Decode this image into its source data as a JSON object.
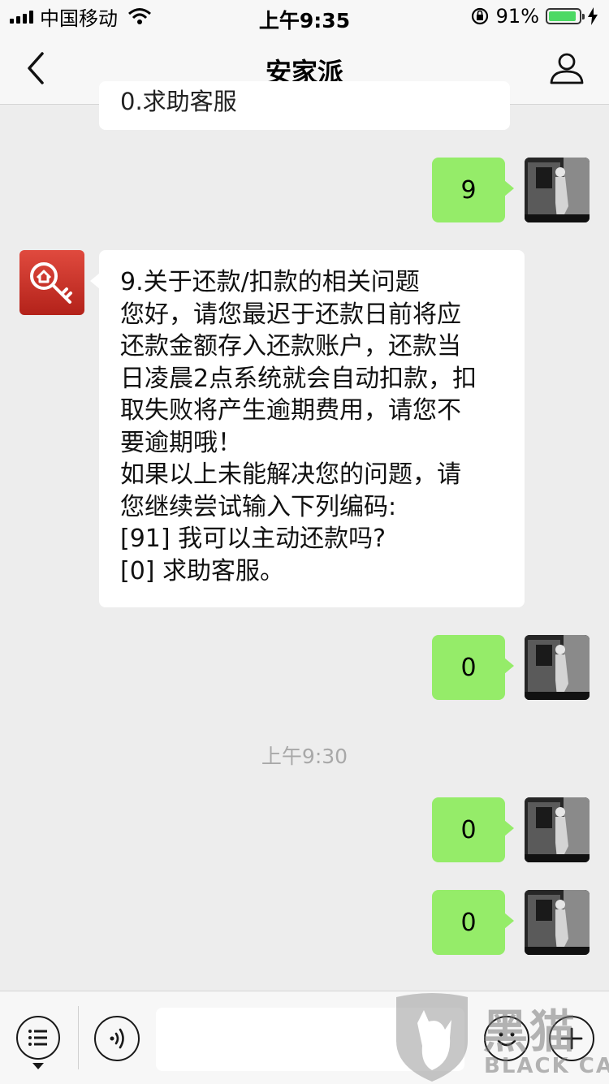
{
  "status_bar": {
    "carrier": "中国移动",
    "time": "上午9:35",
    "battery_percent": "91%",
    "battery_level": 0.91
  },
  "nav": {
    "title": "安家派"
  },
  "messages": {
    "top_partial_text": "0.求助客服",
    "msg1_text": "9",
    "bot_reply_lines": [
      "9.关于还款/扣款的相关问题",
      "您好，请您最迟于还款日前将应",
      "还款金额存入还款账户，还款当",
      "日凌晨2点系统就会自动扣款，扣",
      "取失败将产生逾期费用，请您不",
      "要逾期哦！",
      "如果以上未能解决您的问题，请",
      "您继续尝试输入下列编码:",
      "[91] 我可以主动还款吗?",
      "[0] 求助客服。"
    ],
    "msg2_text": "0",
    "timestamp": "上午9:30",
    "msg3_text": "0",
    "msg4_text": "0"
  },
  "toolbar": {
    "input_value": ""
  },
  "watermark": {
    "chars": "黑猫",
    "en": "BLACK CAT"
  },
  "colors": {
    "self_bubble": "#95ec69",
    "bot_bubble": "#ffffff",
    "background": "#ededed",
    "bot_avatar": "#c8302a"
  }
}
